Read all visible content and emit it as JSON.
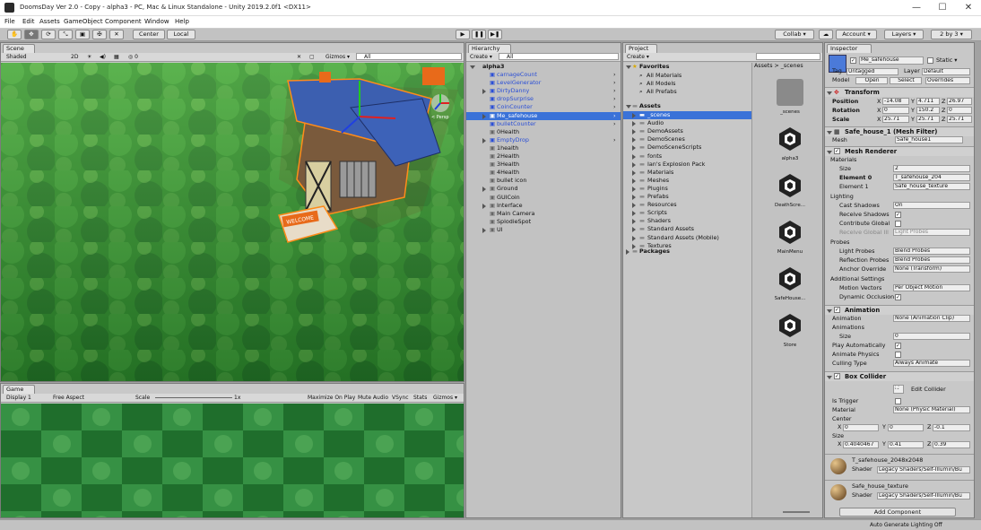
{
  "window": {
    "title": "DoomsDay Ver 2.0 - Copy - alpha3 - PC, Mac & Linux Standalone - Unity 2019.2.0f1 <DX11>",
    "min": "—",
    "max": "☐",
    "close": "✕"
  },
  "menu": [
    "File",
    "Edit",
    "Assets",
    "GameObject",
    "Component",
    "Window",
    "Help"
  ],
  "toolbar": {
    "center": "Center",
    "local": "Local",
    "collab": "Collab ▾",
    "account": "Account ▾",
    "layers": "Layers ▾",
    "layout": "2 by 3 ▾"
  },
  "scene": {
    "tab": "Scene",
    "shading": "Shaded",
    "mode2d": "2D",
    "gizmos": "Gizmos ▾",
    "search": "All",
    "persp": "< Persp"
  },
  "game": {
    "tab": "Game",
    "display": "Display 1",
    "aspect": "Free Aspect",
    "scale_label": "Scale",
    "scale_value": "1x",
    "buttons": [
      "Maximize On Play",
      "Mute Audio",
      "VSync",
      "Stats",
      "Gizmos ▾"
    ]
  },
  "hierarchy": {
    "tab": "Hierarchy",
    "create": "Create ▾",
    "search": "All",
    "root": "alpha3",
    "items": [
      {
        "label": "carnageCount",
        "blue": true,
        "expand": false
      },
      {
        "label": "LevelGenerator",
        "blue": true,
        "expand": false
      },
      {
        "label": "DirtyDanny",
        "blue": true,
        "expand": true
      },
      {
        "label": "dropSurprise",
        "blue": true,
        "expand": false
      },
      {
        "label": "CoinCounter",
        "blue": true,
        "expand": false
      },
      {
        "label": "Me_safehouse",
        "blue": true,
        "expand": true,
        "selected": true
      },
      {
        "label": "bulletCounter",
        "blue": true,
        "expand": false
      },
      {
        "label": "0Health",
        "blue": false,
        "expand": false
      },
      {
        "label": "EmptyDrop",
        "blue": true,
        "expand": true
      },
      {
        "label": "1health",
        "blue": false,
        "expand": false
      },
      {
        "label": "2Health",
        "blue": false,
        "expand": false
      },
      {
        "label": "3Health",
        "blue": false,
        "expand": false
      },
      {
        "label": "4Health",
        "blue": false,
        "expand": false
      },
      {
        "label": "bullet icon",
        "blue": false,
        "expand": false
      },
      {
        "label": "Ground",
        "blue": false,
        "expand": true
      },
      {
        "label": "GUICoin",
        "blue": false,
        "expand": false
      },
      {
        "label": "Interface",
        "blue": false,
        "expand": true
      },
      {
        "label": "Main Camera",
        "blue": false,
        "expand": false
      },
      {
        "label": "SplodieSpot",
        "blue": false,
        "expand": false
      },
      {
        "label": "UI",
        "blue": false,
        "expand": true
      }
    ]
  },
  "project": {
    "tab": "Project",
    "create": "Create ▾",
    "breadcrumb": "Assets > _scenes",
    "favorites": "Favorites",
    "fav_items": [
      "All Materials",
      "All Models",
      "All Prefabs"
    ],
    "assets": "Assets",
    "folders": [
      "_scenes",
      "Audio",
      "DemoAssets",
      "DemoScenes",
      "DemoSceneScripts",
      "fonts",
      "Ian's Explosion Pack",
      "Materials",
      "Meshes",
      "Plugins",
      "Prefabs",
      "Resources",
      "Scripts",
      "Shaders",
      "Standard Assets",
      "Standard Assets (Mobile)",
      "Textures"
    ],
    "packages": "Packages",
    "files": [
      "_scenes",
      "alpha3",
      "DeathScre...",
      "MainMenu",
      "SafeHouse...",
      "Store"
    ]
  },
  "inspector": {
    "tab": "Inspector",
    "name": "Me_safehouse",
    "static": "Static ▾",
    "tag_label": "Tag",
    "tag": "Untagged",
    "layer_label": "Layer",
    "layer": "Default",
    "model_label": "Model",
    "open": "Open",
    "select": "Select",
    "overrides": "Overrides",
    "transform": {
      "title": "Transform",
      "pos_label": "Position",
      "rot_label": "Rotation",
      "scale_label": "Scale",
      "position": [
        "-14.08",
        "4.711",
        "26.97"
      ],
      "rotation": [
        "0",
        "150.2",
        "0"
      ],
      "scale": [
        "25.71",
        "25.71",
        "25.71"
      ]
    },
    "mesh_filter": {
      "title": "Safe_house_1 (Mesh Filter)",
      "mesh_label": "Mesh",
      "mesh": "Safe_house1"
    },
    "mesh_renderer": {
      "title": "Mesh Renderer",
      "materials": "Materials",
      "size_label": "Size",
      "size": "2",
      "el0_label": "Element 0",
      "el0": "T_safehouse_204",
      "el1_label": "Element 1",
      "el1": "Safe_house_texture",
      "lighting": "Lighting",
      "cast_label": "Cast Shadows",
      "cast": "On",
      "recv_label": "Receive Shadows",
      "contrib_label": "Contribute Global",
      "recvgi_label": "Receive Global Ill",
      "recvgi": "Light Probes",
      "probes": "Probes",
      "lp_label": "Light Probes",
      "lp": "Blend Probes",
      "rp_label": "Reflection Probes",
      "rp": "Blend Probes",
      "ao_label": "Anchor Override",
      "ao": "None (Transform)",
      "additional": "Additional Settings",
      "mv_label": "Motion Vectors",
      "mv": "Per Object Motion",
      "occ_label": "Dynamic Occlusion"
    },
    "animation": {
      "title": "Animation",
      "anim_label": "Animation",
      "anim": "None (Animation Clip)",
      "anims_label": "Animations",
      "size_label": "Size",
      "size": "0",
      "pa_label": "Play Automatically",
      "ap_label": "Animate Physics",
      "cm_label": "Culling Type",
      "cm": "Always Animate"
    },
    "box": {
      "title": "Box Collider",
      "edit": "Edit Collider",
      "trig_label": "Is Trigger",
      "mat_label": "Material",
      "mat": "None (Physic Material)",
      "center_label": "Center",
      "center": [
        "0",
        "0",
        "-0.1"
      ],
      "size_label": "Size",
      "size": [
        "0.4040467",
        "0.41",
        "0.39"
      ]
    },
    "materials": [
      {
        "name": "T_safehouse_2048x2048",
        "shader": "Legacy Shaders/Self-Illumin/Bu"
      },
      {
        "name": "Safe_house_texture",
        "shader": "Legacy Shaders/Self-Illumin/Bu"
      }
    ],
    "shader_label": "Shader",
    "add": "Add Component"
  },
  "status": "Auto Generate Lighting Off",
  "house": {
    "welcome": "WELCOME"
  }
}
